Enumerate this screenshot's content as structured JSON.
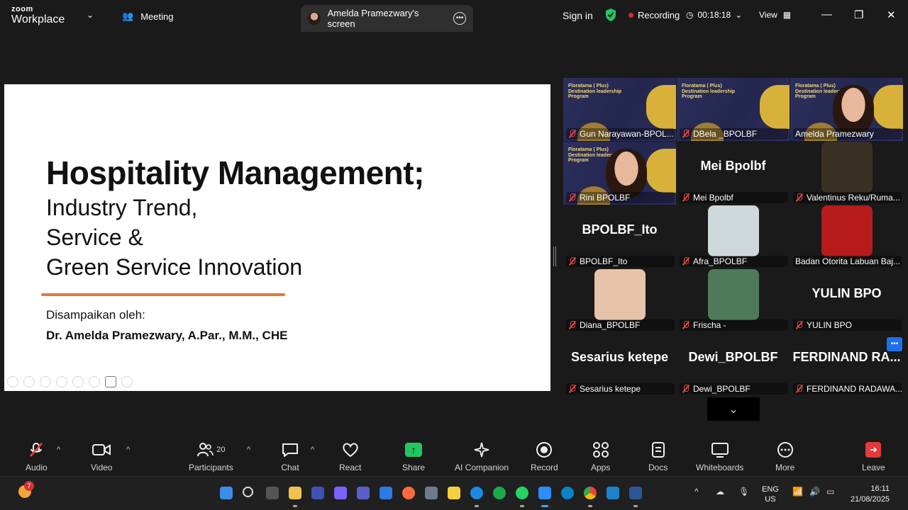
{
  "titlebar": {
    "logo_top": "zoom",
    "logo_bottom": "Workplace",
    "meeting_label": "Meeting",
    "screen_tab_label": "Amelda Pramezwary's screen",
    "signin_label": "Sign in",
    "recording_label": "Recording",
    "timer": "00:18:18",
    "view_label": "View"
  },
  "slide": {
    "title": "Hospitality Management;",
    "subtitle_lines": [
      "Industry Trend,",
      "Service &",
      "Green Service Innovation"
    ],
    "presented_by": "Disampaikan oleh:",
    "presenter": "Dr. Amelda Pramezwary, A.Par., M.M., CHE"
  },
  "banner_text": "Floratama ( Plus) Destination leadership Program",
  "participants": [
    {
      "label": "Gun Narayawan-BPOL...",
      "kind": "banner",
      "muted": true
    },
    {
      "label": "DBela _BPOLBF",
      "kind": "banner",
      "muted": true
    },
    {
      "label": "Amelda Pramezwary",
      "kind": "video-speaker",
      "muted": false
    },
    {
      "label": "Rini BPOLBF",
      "kind": "video",
      "muted": true
    },
    {
      "label": "Mei Bpolbf",
      "big": "Mei Bpolbf",
      "kind": "name",
      "muted": true
    },
    {
      "label": "Valentinus Reku/Ruma...",
      "kind": "thumb",
      "thumb_color": "#3a3024",
      "muted": true
    },
    {
      "label": "BPOLBF_Ito",
      "big": "BPOLBF_Ito",
      "kind": "name",
      "muted": true
    },
    {
      "label": "Afra_BPOLBF",
      "kind": "thumb",
      "thumb_color": "#cfd8dc",
      "muted": true
    },
    {
      "label": "Badan Otorita Labuan Baj...",
      "kind": "thumb",
      "thumb_color": "#b71c1c",
      "muted": false
    },
    {
      "label": "Diana_BPOLBF",
      "kind": "thumb",
      "thumb_color": "#e7c3a9",
      "muted": true
    },
    {
      "label": "Frischa -",
      "kind": "thumb",
      "thumb_color": "#4f7a5a",
      "muted": true
    },
    {
      "label": "YULIN BPO",
      "big": "YULIN BPO",
      "kind": "name",
      "muted": true
    },
    {
      "label": "Sesarius ketepe",
      "big": "Sesarius ketepe",
      "kind": "name",
      "muted": true
    },
    {
      "label": "Dewi_BPOLBF",
      "big": "Dewi_BPOLBF",
      "kind": "name",
      "muted": true
    },
    {
      "label": "FERDINAND RADAWA...",
      "big": "FERDINAND RA...",
      "kind": "name",
      "muted": true
    }
  ],
  "toolbar": {
    "audio": "Audio",
    "video": "Video",
    "participants": "Participants",
    "participants_count": "20",
    "chat": "Chat",
    "react": "React",
    "share": "Share",
    "ai_companion": "AI Companion",
    "record": "Record",
    "apps": "Apps",
    "docs": "Docs",
    "whiteboards": "Whiteboards",
    "more": "More",
    "leave": "Leave"
  },
  "taskbar": {
    "weather_badge": "7",
    "lang_top": "ENG",
    "lang_bottom": "US",
    "time": "16:11",
    "date": "21/08/2025"
  },
  "colors": {
    "accent_green": "#23d96e",
    "record_red": "#e02828",
    "slide_underline": "#e07b3a"
  }
}
